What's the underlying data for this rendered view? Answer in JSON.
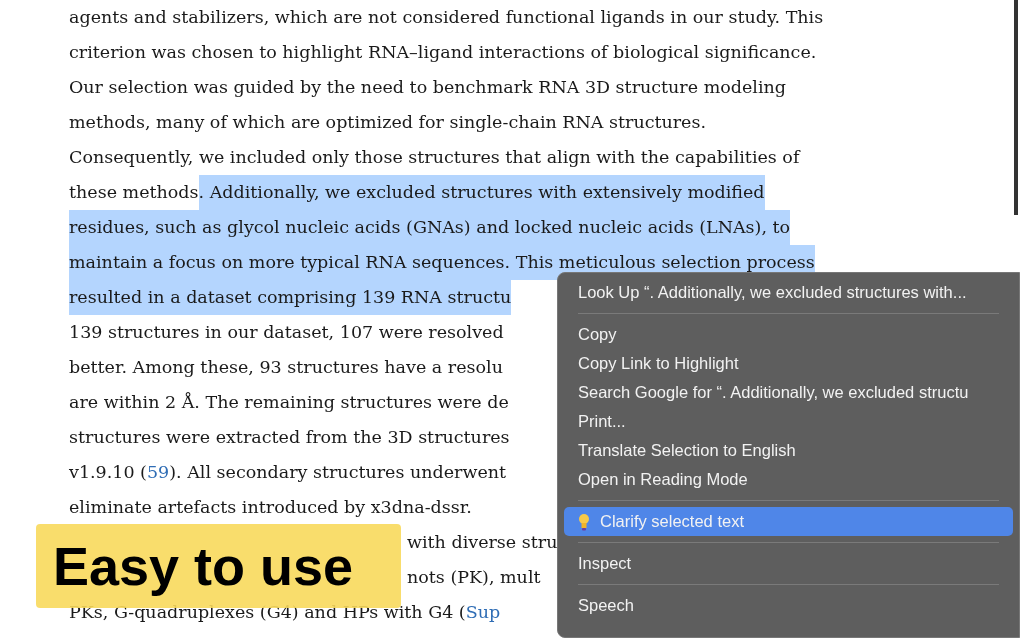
{
  "article": {
    "lines": [
      {
        "covered": false,
        "segments": [
          {
            "kind": "text",
            "text": "agents and stabilizers, which are not considered functional ligands in our study. This",
            "selected": false
          }
        ]
      },
      {
        "covered": false,
        "segments": [
          {
            "kind": "text",
            "text": "criterion was chosen to highlight RNA–ligand interactions of biological significance.",
            "selected": false
          }
        ]
      },
      {
        "covered": false,
        "segments": [
          {
            "kind": "text",
            "text": "Our selection was guided by the need to benchmark RNA 3D structure modeling",
            "selected": false
          }
        ]
      },
      {
        "covered": false,
        "segments": [
          {
            "kind": "text",
            "text": "methods, many of which are optimized for single-chain RNA structures.",
            "selected": false
          }
        ]
      },
      {
        "covered": false,
        "segments": [
          {
            "kind": "text",
            "text": "Consequently, we included only those structures that align with the capabilities of",
            "selected": false
          }
        ]
      },
      {
        "covered": false,
        "segments": [
          {
            "kind": "text",
            "text": "these methods",
            "selected": false
          },
          {
            "kind": "text",
            "text": ". Additionally, we excluded structures with extensively modified",
            "selected": true
          }
        ]
      },
      {
        "covered": false,
        "segments": [
          {
            "kind": "text",
            "text": "residues, such as glycol nucleic acids (GNAs) and locked nucleic acids (LNAs), to",
            "selected": true
          }
        ]
      },
      {
        "covered": false,
        "segments": [
          {
            "kind": "text",
            "text": "maintain a focus on more typical RNA sequences. This meticulous selection process",
            "selected": true
          }
        ]
      },
      {
        "covered": false,
        "segments": [
          {
            "kind": "text",
            "text": "resulted in a dataset comprising 139 RNA structu",
            "selected": true
          }
        ]
      },
      {
        "covered": false,
        "segments": [
          {
            "kind": "text",
            "text": "139 structures in our dataset, 107 were resolved",
            "selected": false
          }
        ]
      },
      {
        "covered": false,
        "segments": [
          {
            "kind": "text",
            "text": "better. Among these, 93 structures have a resolu",
            "selected": false
          }
        ]
      },
      {
        "covered": false,
        "segments": [
          {
            "kind": "text",
            "text": "are within 2 Å. The remaining structures were de",
            "selected": false
          }
        ]
      },
      {
        "covered": false,
        "segments": [
          {
            "kind": "text",
            "text": "structures were extracted from the 3D structures",
            "selected": false
          }
        ]
      },
      {
        "covered": false,
        "segments": [
          {
            "kind": "text",
            "text": "v1.9.10 (",
            "selected": false
          },
          {
            "kind": "link",
            "text": "59",
            "selected": false
          },
          {
            "kind": "text",
            "text": "). All secondary structures underwent",
            "selected": false
          }
        ]
      },
      {
        "covered": false,
        "segments": [
          {
            "kind": "text",
            "text": "eliminate artefacts introduced by x3dna-dssr.",
            "selected": false
          }
        ]
      },
      {
        "covered": true,
        "segments": [
          {
            "kind": "text",
            "text": "with diverse stru",
            "selected": false
          }
        ]
      },
      {
        "covered": true,
        "segments": [
          {
            "kind": "text",
            "text": "nots (PK), mult",
            "selected": false
          }
        ]
      },
      {
        "covered": false,
        "segments": [
          {
            "kind": "text",
            "text": "PKs, G-quadruplexes (G4) and HPs with G4 (",
            "selected": false
          },
          {
            "kind": "link",
            "text": "Sup",
            "selected": false
          }
        ]
      }
    ]
  },
  "banner": {
    "text": "Easy to use"
  },
  "context_menu": {
    "items": [
      {
        "kind": "item",
        "label": "Look Up “. Additionally, we excluded structures with...",
        "selected": false,
        "has_icon": false
      },
      {
        "kind": "separator"
      },
      {
        "kind": "item",
        "label": "Copy",
        "selected": false,
        "has_icon": false
      },
      {
        "kind": "item",
        "label": "Copy Link to Highlight",
        "selected": false,
        "has_icon": false
      },
      {
        "kind": "item",
        "label": "Search Google for “. Additionally, we excluded structu",
        "selected": false,
        "has_icon": false
      },
      {
        "kind": "item",
        "label": "Print...",
        "selected": false,
        "has_icon": false
      },
      {
        "kind": "item",
        "label": "Translate Selection to English",
        "selected": false,
        "has_icon": false
      },
      {
        "kind": "item",
        "label": "Open in Reading Mode",
        "selected": false,
        "has_icon": false
      },
      {
        "kind": "separator"
      },
      {
        "kind": "item",
        "label": "Clarify selected text",
        "selected": true,
        "has_icon": true
      },
      {
        "kind": "separator"
      },
      {
        "kind": "item",
        "label": "Inspect",
        "selected": false,
        "has_icon": false
      },
      {
        "kind": "separator"
      },
      {
        "kind": "item",
        "label": "Speech",
        "selected": false,
        "has_icon": false
      }
    ]
  }
}
